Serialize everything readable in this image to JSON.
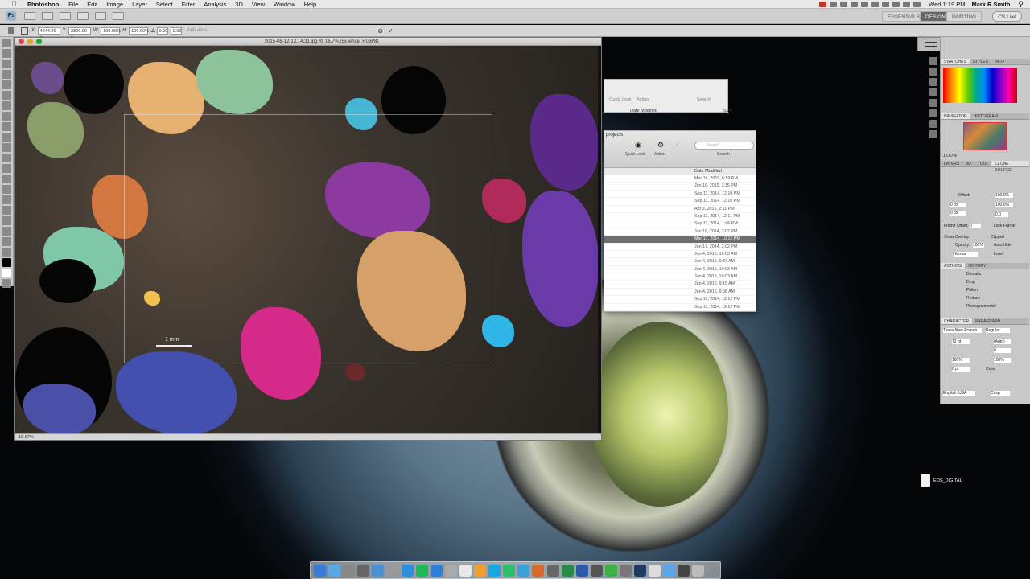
{
  "menubar": {
    "app_name": "Photoshop",
    "items": [
      "File",
      "Edit",
      "Image",
      "Layer",
      "Select",
      "Filter",
      "Analysis",
      "3D",
      "View",
      "Window",
      "Help"
    ],
    "clock": "Wed 1:19 PM",
    "user": "Mark R Smith"
  },
  "appbar": {
    "workspaces": [
      "ESSENTIALS",
      "DESIGN",
      "PAINTING"
    ],
    "active_workspace": "DESIGN",
    "cs_live": "CS Live"
  },
  "options": {
    "w_value": "4344.00 p",
    "h_value": "2896.00 p",
    "w_pct": "100.00%",
    "h_pct": "100.00%",
    "angle": "0.00",
    "anti_alias": "Anti-alias"
  },
  "document": {
    "title": "2015-08-12-13.14.31.jpg @ 16.7% (5x-white, RGB/8)",
    "scale_label": "1 mm",
    "zoom": "16.67%"
  },
  "finder": {
    "back_toolbar": [
      "Quick Look",
      "Action",
      "Search"
    ],
    "back_header": "Date Modified",
    "back_size": "Size",
    "front_title": "projects",
    "front_toolbar": [
      "Quick Look",
      "Action",
      "Search"
    ],
    "search_placeholder": "Search",
    "column_header": "Date Modified",
    "dates": [
      "Mar 16, 2015, 6:59 PM",
      "Jun 16, 2015, 3:15 PM",
      "Sep 11, 2014, 12:10 PM",
      "Sep 11, 2014, 12:10 PM",
      "Apr 3, 2015, 2:11 PM",
      "Sep 11, 2014, 12:11 PM",
      "Sep 11, 2014, 1:06 PM",
      "Jun 18, 2014, 3:02 PM",
      "Mar 17, 2014, 10:12 PM",
      "Jan 17, 2014, 2:02 PM",
      "Jun 4, 2015, 10:03 AM",
      "Jun 4, 2015, 9:37 AM",
      "Jun 4, 2015, 10:03 AM",
      "Jun 4, 2015, 10:03 AM",
      "Jun 4, 2015, 9:15 AM",
      "Jun 4, 2015, 9:08 AM",
      "Sep 11, 2014, 12:12 PM",
      "Sep 11, 2014, 12:12 PM"
    ],
    "selected_index": 8
  },
  "rpanel": {
    "meter_value": "9999",
    "swatch_tabs": [
      "SWATCHES",
      "STYLES",
      "INFO"
    ],
    "navigator_tabs": [
      "NAVIGATOR",
      "HISTOGRAM"
    ],
    "nav_zoom": "16.67%",
    "clone_tabs": [
      "LAYERS",
      "3D",
      "TOOL",
      "CLONE SOURCE"
    ],
    "offset_label": "Offset:",
    "offset_x": "0 px",
    "offset_y": "0 px",
    "scale_w": "100.0%",
    "scale_h": "100.0%",
    "angle": "0.0",
    "frame_offset_label": "Frame Offset:",
    "frame_offset": "0",
    "lock_frame": "Lock Frame",
    "show_overlay": "Show Overlay",
    "clipped": "Clipped",
    "opacity_label": "Opacity:",
    "opacity": "100%",
    "auto_hide": "Auto Hide",
    "blend_mode": "Normal",
    "invert": "Invert",
    "actions_tabs": [
      "ACTIONS",
      "HISTORY"
    ],
    "actions": [
      "Dentalis",
      "Drop",
      "Pollen",
      "Reduce",
      "Photogrammetry"
    ],
    "character_tabs": [
      "CHARACTER",
      "PARAGRAPH"
    ],
    "font_family": "Times New Roman",
    "font_style": "Regular",
    "font_size": "72 pt",
    "leading": "(Auto)",
    "kerning": "0",
    "tracking": "0",
    "vscale": "100%",
    "hscale": "100%",
    "baseline": "0 pt",
    "color_label": "Color:",
    "language": "English: USA",
    "antialias": "Crisp"
  },
  "desktop": {
    "icon_label": "EOS_DIGITAL"
  },
  "colors": {
    "accent_selected_row": "#6d6d6d",
    "menubar_bg": "#e8e8e8",
    "panel_bg": "#c8c8c8"
  }
}
